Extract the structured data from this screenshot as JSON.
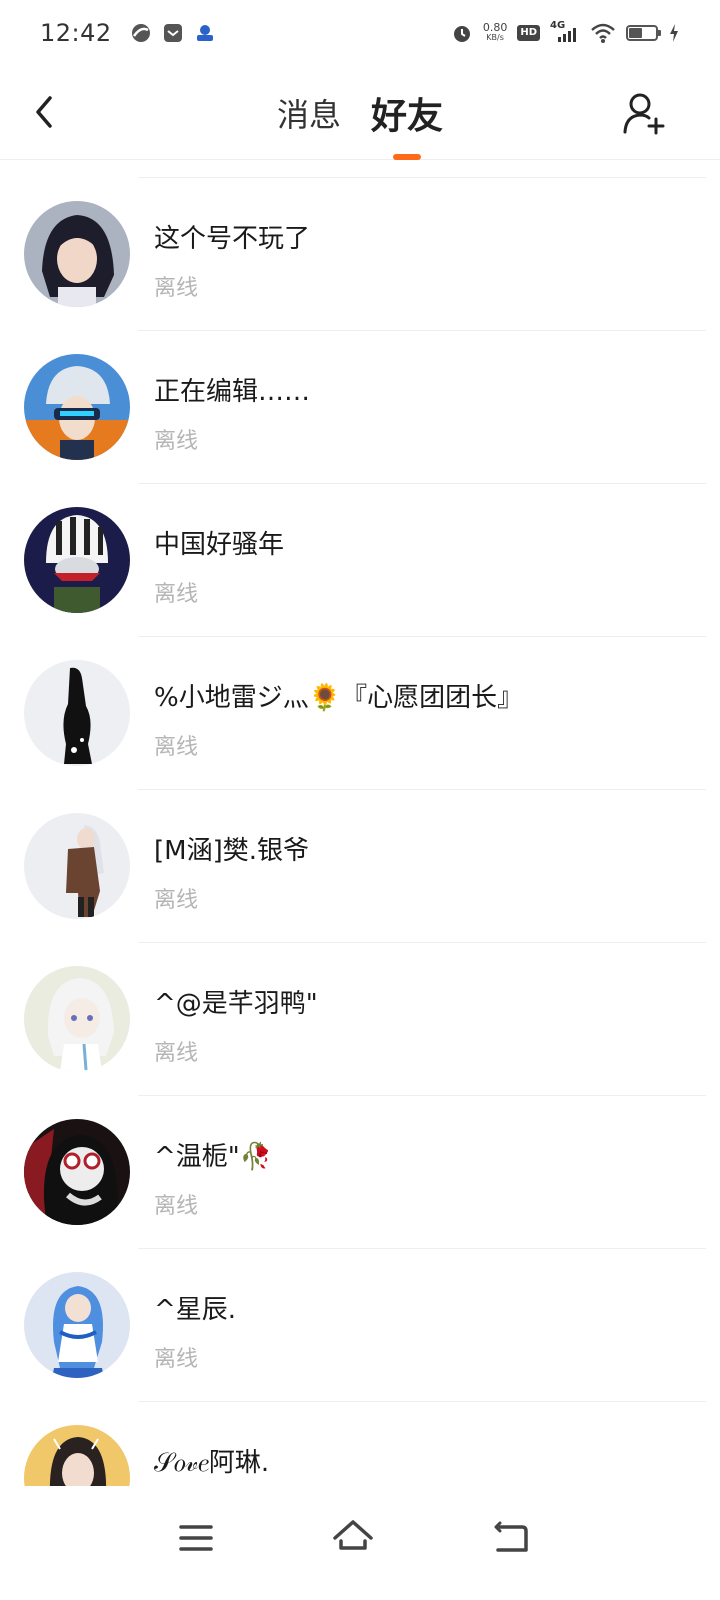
{
  "status_bar": {
    "time": "12:42",
    "left_icons": [
      "app-icon",
      "message-icon",
      "badge-icon"
    ],
    "net_speed_value": "0.80",
    "net_speed_unit": "KB/s",
    "hd_label": "HD",
    "network_type": "4G",
    "battery_level": 0.5
  },
  "header": {
    "tabs": [
      {
        "label": "消息",
        "active": false
      },
      {
        "label": "好友",
        "active": true
      }
    ],
    "accent_color": "#ff6a1a",
    "back_icon": "chevron-left-icon",
    "add_friend_icon": "add-user-icon"
  },
  "friends": [
    {
      "name": "这个号不玩了",
      "status": "离线"
    },
    {
      "name": "正在编辑……",
      "status": "离线"
    },
    {
      "name": "中国好骚年",
      "status": "离线"
    },
    {
      "name": "%小地雷ジ灬🌻『心愿团团长』",
      "status": "离线"
    },
    {
      "name": "[M涵]樊.银爷",
      "status": "离线"
    },
    {
      "name": "^@是芊羽鸭\"",
      "status": "离线"
    },
    {
      "name": "^温栀\"🥀",
      "status": "离线"
    },
    {
      "name": "^星辰.",
      "status": "离线"
    },
    {
      "name": "𝒮𝑜𝓋𝑒阿琳.",
      "status": ""
    }
  ],
  "nav_bar": {
    "icons": [
      "menu-icon",
      "home-icon",
      "back-icon"
    ]
  }
}
